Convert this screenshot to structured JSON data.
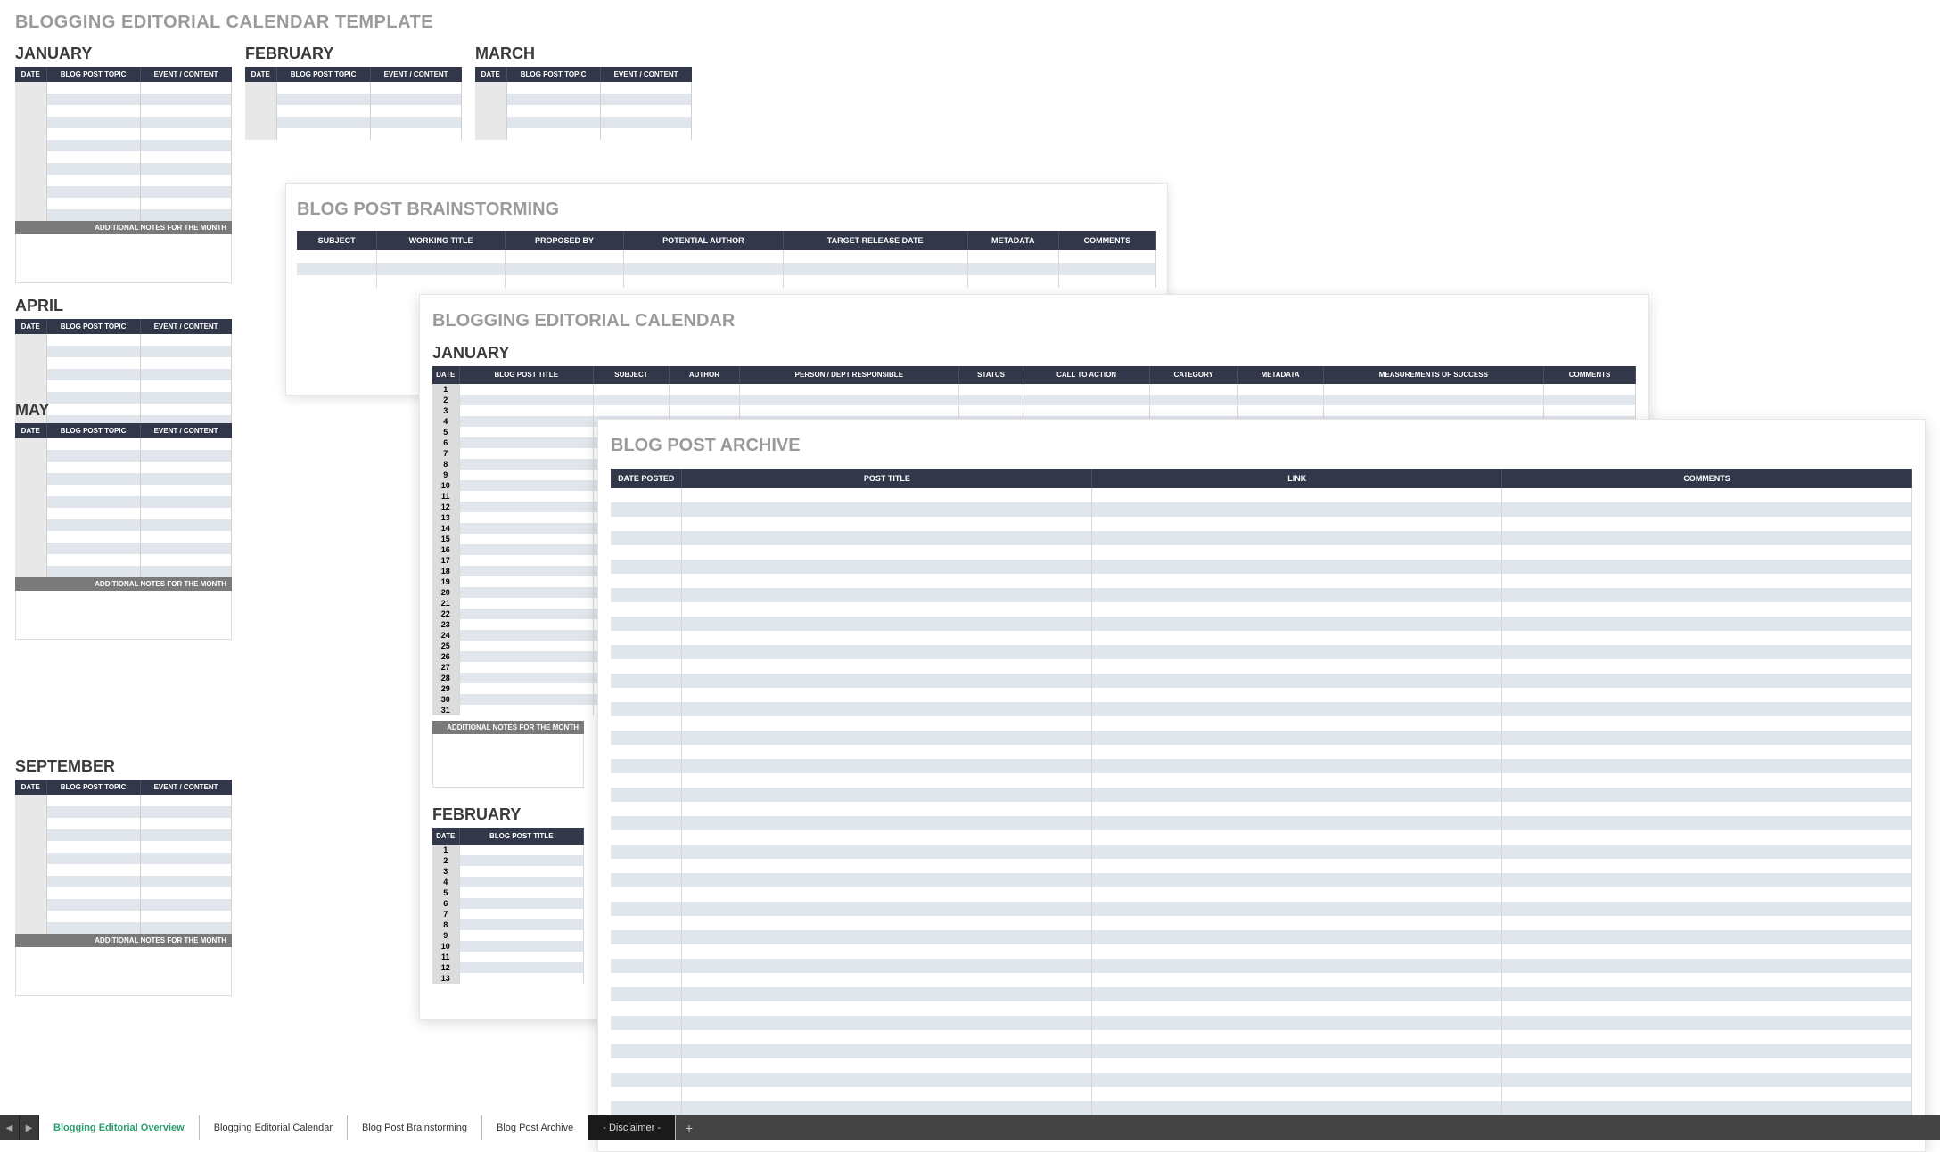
{
  "page_title": "BLOGGING EDITORIAL CALENDAR TEMPLATE",
  "template_months_row1": [
    "JANUARY",
    "FEBRUARY",
    "MARCH",
    "APRIL"
  ],
  "template_months_row2": [
    "MAY"
  ],
  "template_months_row3": [
    "SEPTEMBER"
  ],
  "template_headers": [
    "DATE",
    "BLOG POST TOPIC",
    "EVENT / CONTENT"
  ],
  "notes_label": "ADDITIONAL NOTES FOR THE MONTH",
  "brainstorm": {
    "title": "BLOG POST BRAINSTORMING",
    "headers": [
      "SUBJECT",
      "WORKING TITLE",
      "PROPOSED BY",
      "POTENTIAL AUTHOR",
      "TARGET RELEASE DATE",
      "METADATA",
      "COMMENTS"
    ]
  },
  "editorial": {
    "title": "BLOGGING EDITORIAL CALENDAR",
    "month1": "JANUARY",
    "month2": "FEBRUARY",
    "headers": [
      "DATE",
      "BLOG POST TITLE",
      "SUBJECT",
      "AUTHOR",
      "PERSON / DEPT RESPONSIBLE",
      "STATUS",
      "CALL TO ACTION",
      "CATEGORY",
      "METADATA",
      "MEASUREMENTS OF SUCCESS",
      "COMMENTS"
    ],
    "headers2": [
      "DATE",
      "BLOG POST TITLE"
    ],
    "days1": [
      1,
      2,
      3,
      4,
      5,
      6,
      7,
      8,
      9,
      10,
      11,
      12,
      13,
      14,
      15,
      16,
      17,
      18,
      19,
      20,
      21,
      22,
      23,
      24,
      25,
      26,
      27,
      28,
      29,
      30,
      31
    ],
    "days2": [
      1,
      2,
      3,
      4,
      5,
      6,
      7,
      8,
      9,
      10,
      11,
      12,
      13
    ]
  },
  "archive": {
    "title": "BLOG POST ARCHIVE",
    "headers": [
      "DATE POSTED",
      "POST TITLE",
      "LINK",
      "COMMENTS"
    ]
  },
  "tabs": [
    "Blogging Editorial Overview",
    "Blogging Editorial Calendar",
    "Blog Post Brainstorming",
    "Blog Post Archive",
    "- Disclaimer -"
  ],
  "active_tab": 0,
  "nav_prev": "◀",
  "nav_next": "▶",
  "add_tab": "+"
}
